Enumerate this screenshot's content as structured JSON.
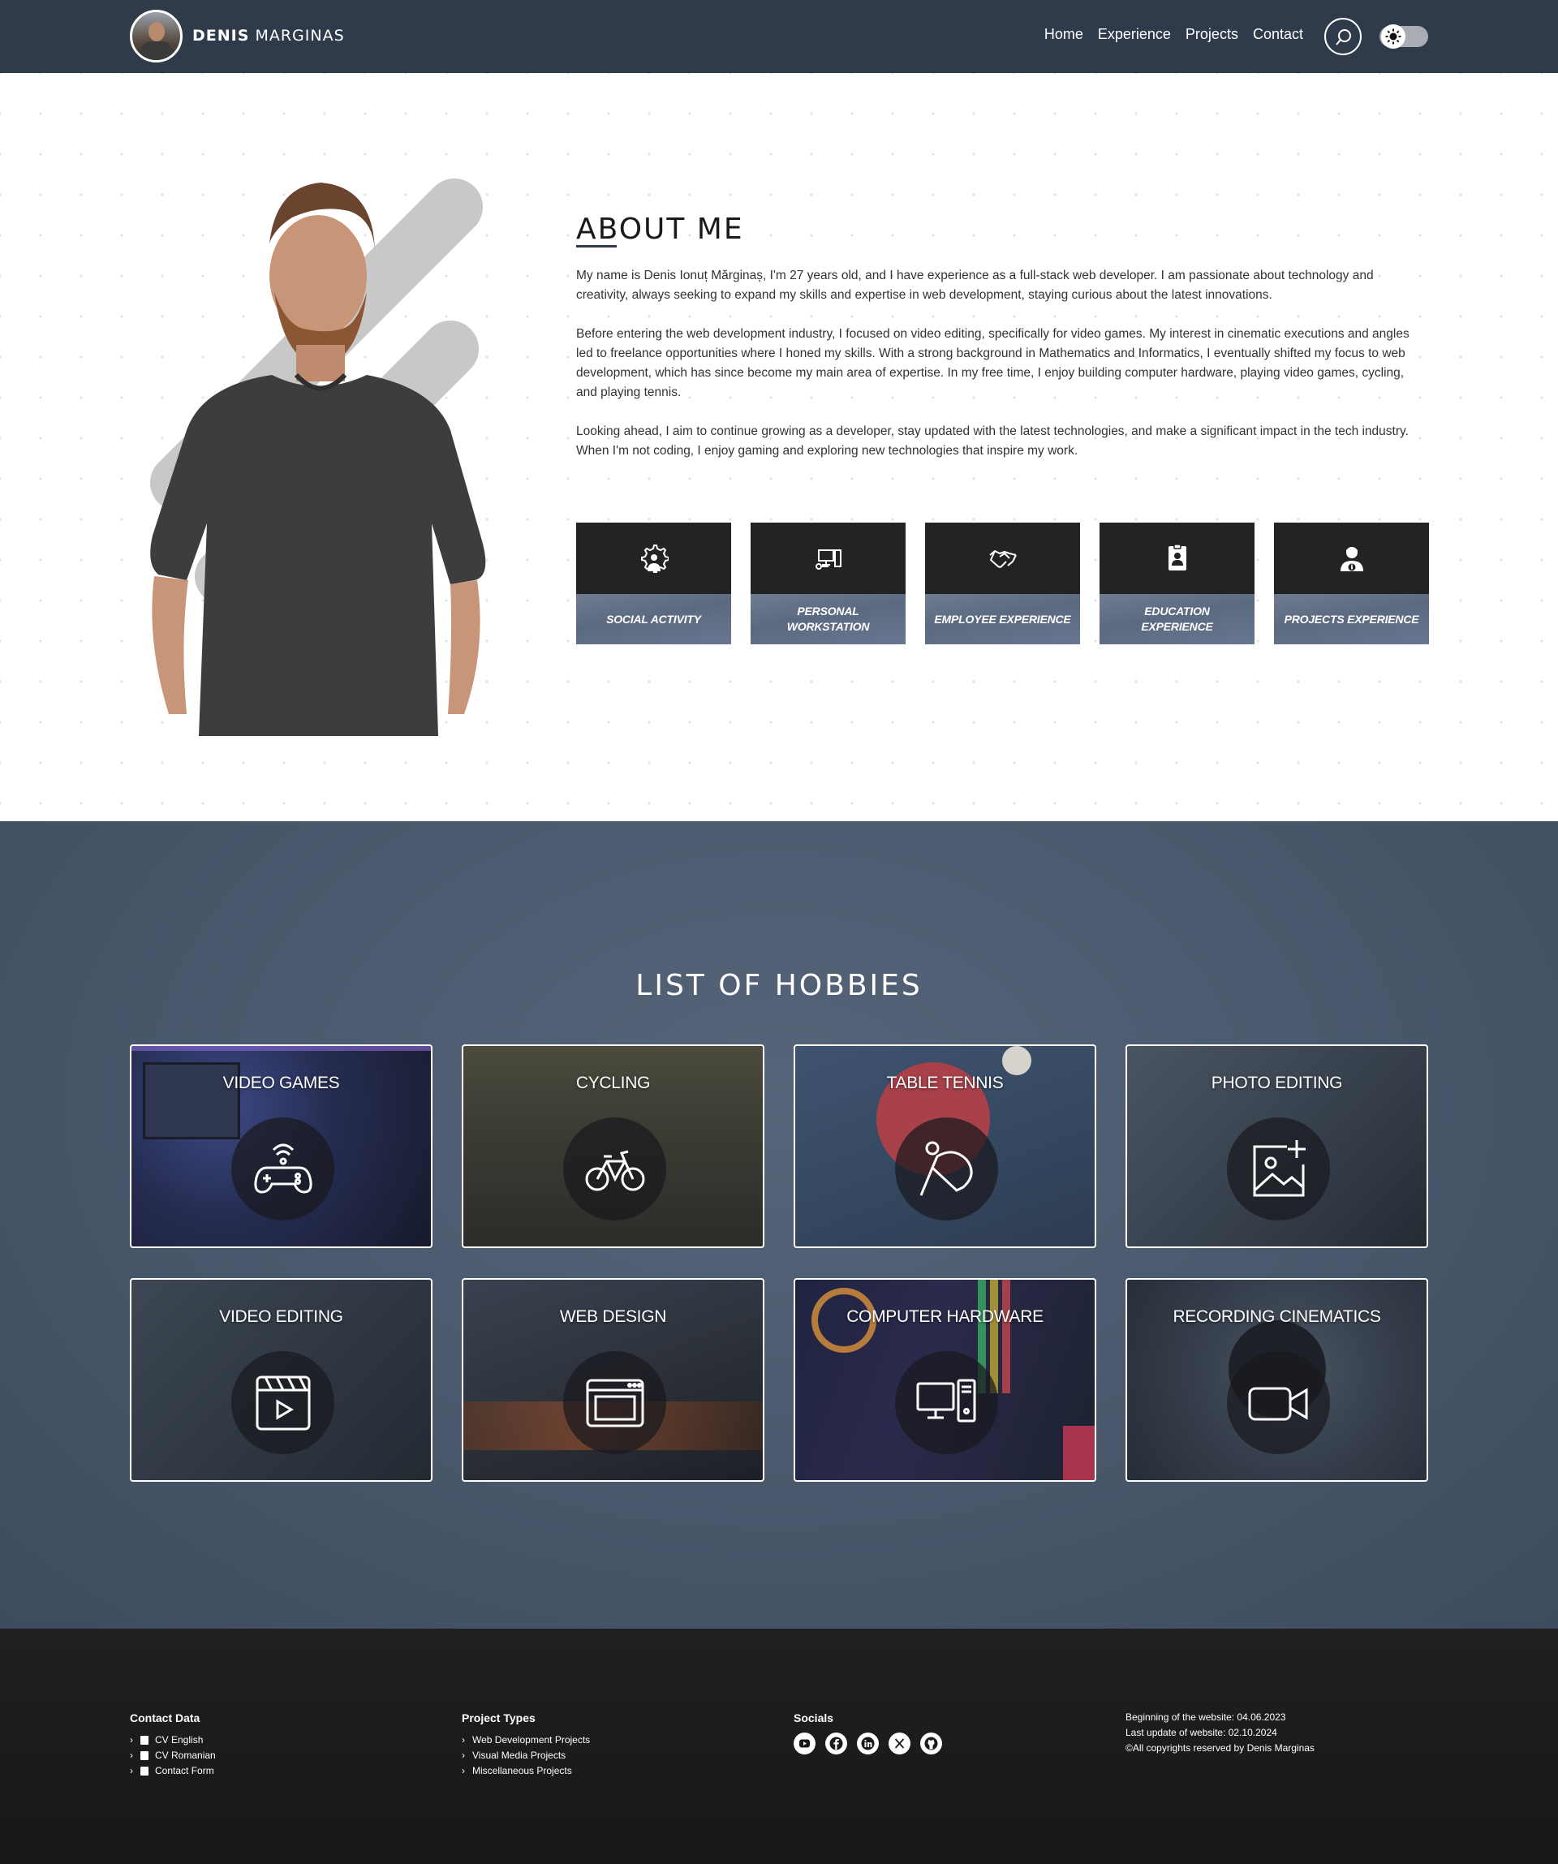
{
  "nav": {
    "brand_first": "Denis",
    "brand_last": "Marginas",
    "links": [
      "Home",
      "Experience",
      "Projects",
      "Contact"
    ]
  },
  "about": {
    "title": "ABOUT ME",
    "paragraphs": [
      "My name is Denis Ionuț Mărginaș, I'm 27 years old, and I have experience as a full-stack web developer. I am passionate about technology and creativity, always seeking to expand my skills and expertise in web development, staying curious about the latest innovations.",
      "Before entering the web development industry, I focused on video editing, specifically for video games. My interest in cinematic executions and angles led to freelance opportunities where I honed my skills. With a strong background in Mathematics and Informatics, I eventually shifted my focus to web development, which has since become my main area of expertise. In my free time, I enjoy building computer hardware, playing video games, cycling, and playing tennis.",
      "Looking ahead, I aim to continue growing as a developer, stay updated with the latest technologies, and make a significant impact in the tech industry. When I'm not coding, I enjoy gaming and exploring new technologies that inspire my work."
    ],
    "cards": [
      {
        "label": "Social Activity",
        "icon": "gear-person-icon"
      },
      {
        "label": "Personal Workstation",
        "icon": "workstation-icon"
      },
      {
        "label": "Employee Experience",
        "icon": "handshake-icon"
      },
      {
        "label": "Education Experience",
        "icon": "id-badge-icon"
      },
      {
        "label": "Projects Experience",
        "icon": "user-info-icon"
      }
    ]
  },
  "hobbies": {
    "title": "LIST OF HOBBIES",
    "items": [
      {
        "label": "Video Games",
        "icon": "gamepad-icon"
      },
      {
        "label": "Cycling",
        "icon": "bicycle-icon"
      },
      {
        "label": "Table Tennis",
        "icon": "ping-pong-icon"
      },
      {
        "label": "Photo Editing",
        "icon": "image-add-icon"
      },
      {
        "label": "Video Editing",
        "icon": "clapperboard-icon"
      },
      {
        "label": "Web Design",
        "icon": "browser-window-icon"
      },
      {
        "label": "Computer Hardware",
        "icon": "desktop-computer-icon"
      },
      {
        "label": "Recording Cinematics",
        "icon": "video-camera-icon"
      }
    ]
  },
  "footer": {
    "contact": {
      "title": "Contact Data",
      "items": [
        "CV English",
        "CV Romanian",
        "Contact Form"
      ]
    },
    "projects": {
      "title": "Project Types",
      "items": [
        "Web Development Projects",
        "Visual Media Projects",
        "Miscellaneous Projects"
      ]
    },
    "socials": {
      "title": "Socials",
      "items": [
        "youtube-icon",
        "facebook-icon",
        "linkedin-icon",
        "x-icon",
        "github-icon"
      ]
    },
    "info": [
      "Beginning of the website: 04.06.2023",
      "Last update of website: 02.10.2024",
      "©All copyrights reserved by Denis Marginas"
    ]
  }
}
